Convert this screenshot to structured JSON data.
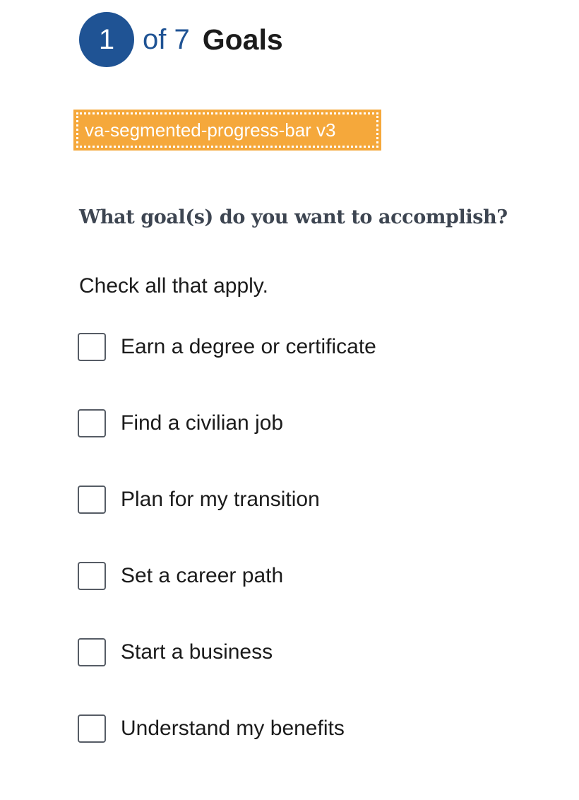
{
  "progress": {
    "current_step": "1",
    "of_total": "of 7",
    "step_title": "Goals",
    "accent_color": "#1f5394"
  },
  "component_tag": {
    "label": "va-segmented-progress-bar v3",
    "color": "#f5a83b"
  },
  "question": {
    "text": "What goal(s) do you want to accomplish?",
    "hint": "Check all that apply."
  },
  "options": [
    {
      "label": "Earn a degree or certificate",
      "checked": false
    },
    {
      "label": "Find a civilian job",
      "checked": false
    },
    {
      "label": "Plan for my transition",
      "checked": false
    },
    {
      "label": "Set a career path",
      "checked": false
    },
    {
      "label": "Start a business",
      "checked": false
    },
    {
      "label": "Understand my benefits",
      "checked": false
    }
  ]
}
